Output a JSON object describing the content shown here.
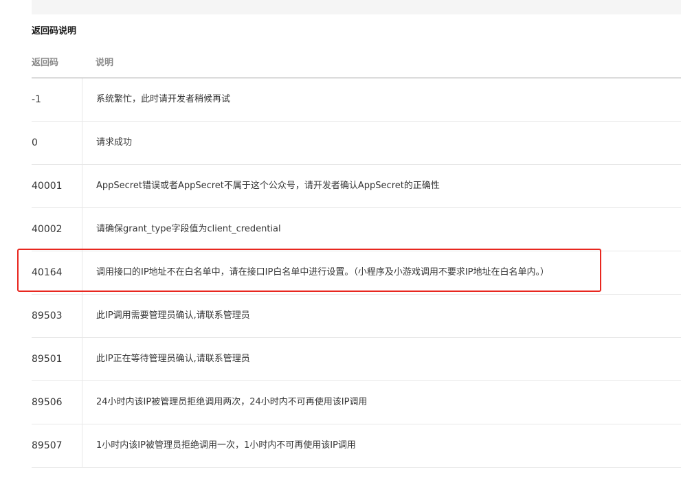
{
  "section": {
    "title": "返回码说明"
  },
  "table": {
    "headers": {
      "code": "返回码",
      "desc": "说明"
    },
    "rows": [
      {
        "code": "-1",
        "desc": "系统繁忙，此时请开发者稍候再试"
      },
      {
        "code": "0",
        "desc": "请求成功"
      },
      {
        "code": "40001",
        "desc": "AppSecret错误或者AppSecret不属于这个公众号，请开发者确认AppSecret的正确性"
      },
      {
        "code": "40002",
        "desc": "请确保grant_type字段值为client_credential"
      },
      {
        "code": "40164",
        "desc": "调用接口的IP地址不在白名单中，请在接口IP白名单中进行设置。（小程序及小游戏调用不要求IP地址在白名单内。）"
      },
      {
        "code": "89503",
        "desc": "此IP调用需要管理员确认,请联系管理员"
      },
      {
        "code": "89501",
        "desc": "此IP正在等待管理员确认,请联系管理员"
      },
      {
        "code": "89506",
        "desc": "24小时内该IP被管理员拒绝调用两次，24小时内不可再使用该IP调用"
      },
      {
        "code": "89507",
        "desc": "1小时内该IP被管理员拒绝调用一次，1小时内不可再使用该IP调用"
      }
    ]
  },
  "annotation": {
    "highlight_color": "#e8271f",
    "highlighted_code": "40164"
  }
}
